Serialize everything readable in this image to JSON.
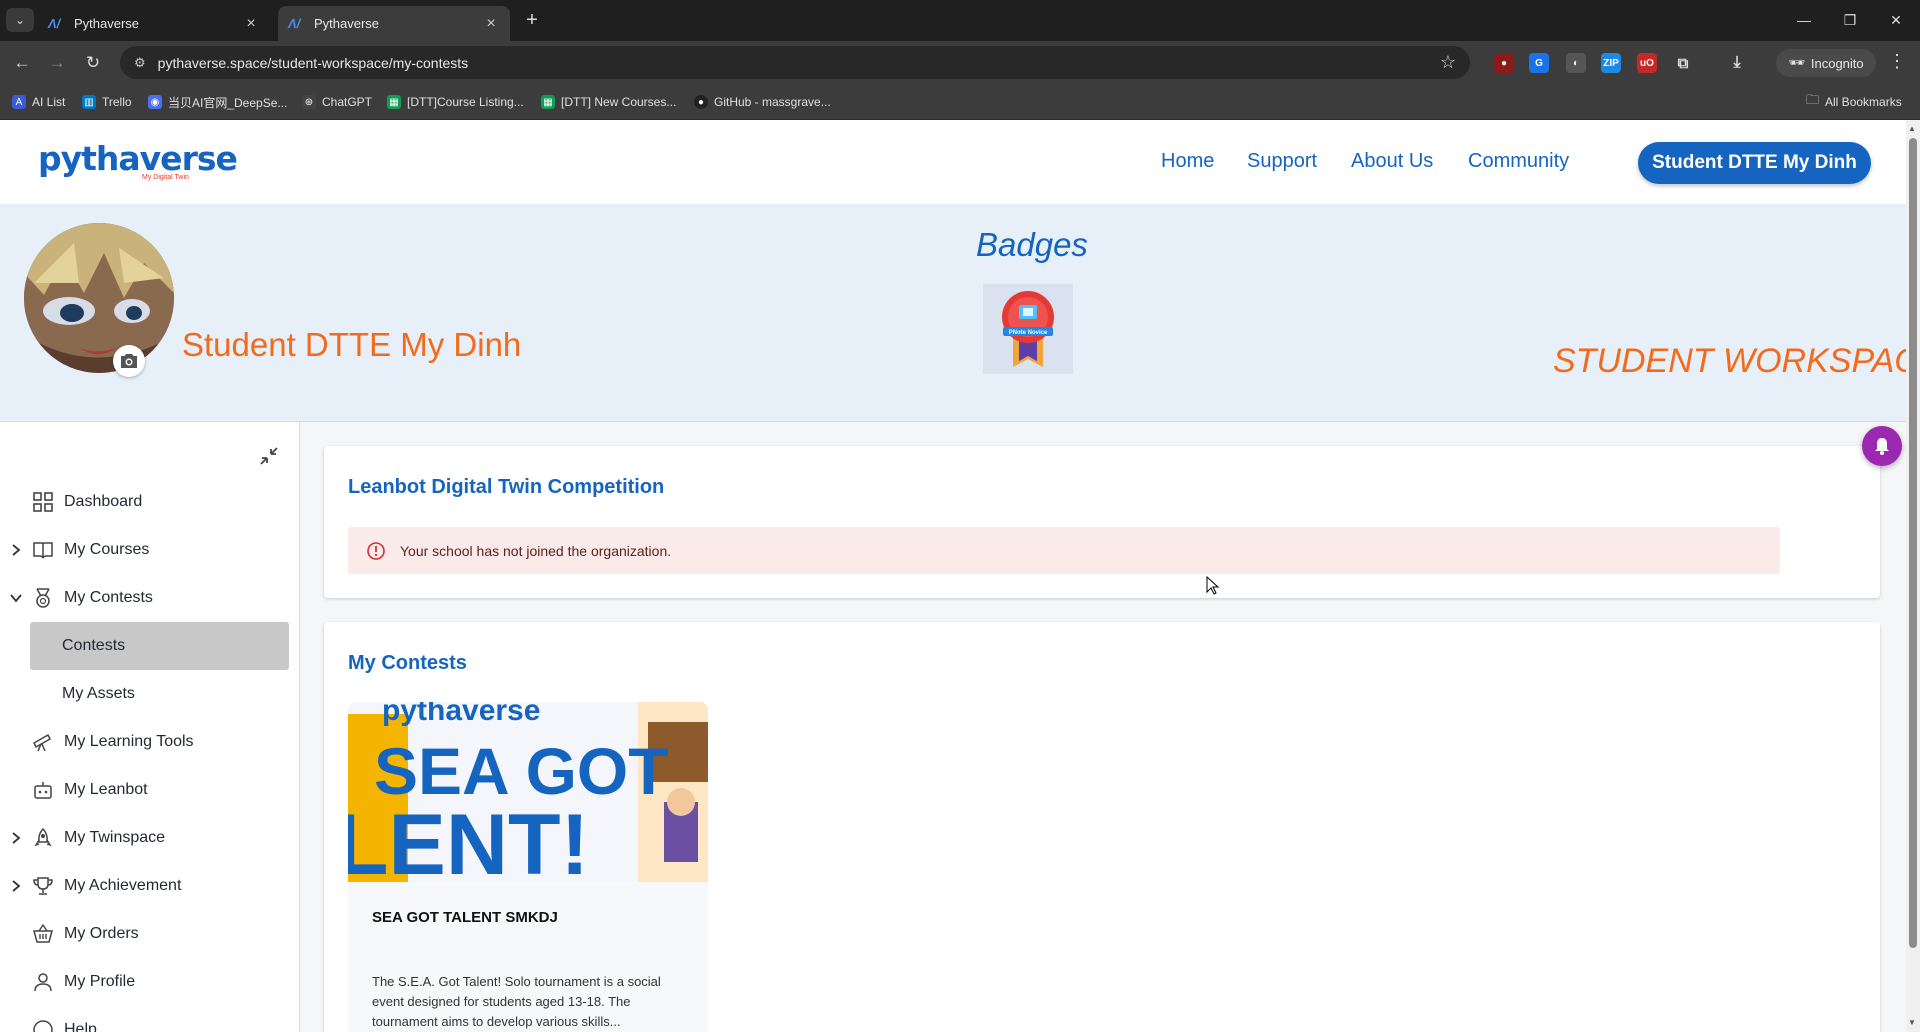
{
  "browser": {
    "tabs": [
      {
        "title": "Pythaverse"
      },
      {
        "title": "Pythaverse"
      }
    ],
    "url": "pythaverse.space/student-workspace/my-contests",
    "incognito_label": "Incognito",
    "bookmarks": [
      {
        "label": "AI List"
      },
      {
        "label": "Trello"
      },
      {
        "label": "当贝AI官网_DeepSe..."
      },
      {
        "label": "ChatGPT"
      },
      {
        "label": "[DTT]Course Listing..."
      },
      {
        "label": "[DTT] New Courses..."
      },
      {
        "label": "GitHub - massgrave..."
      }
    ],
    "all_bookmarks": "All Bookmarks"
  },
  "header": {
    "logo_text": "pythaverse",
    "logo_sub": "My Digital Twin",
    "nav": [
      {
        "label": "Home"
      },
      {
        "label": "Support"
      },
      {
        "label": "About Us"
      },
      {
        "label": "Community"
      }
    ],
    "profile_button": "Student DTTE My Dinh"
  },
  "hero": {
    "student_name": "Student DTTE My Dinh",
    "badges_title": "Badges",
    "badge_label": "PNote Novice",
    "workspace_title": "STUDENT WORKSPACE"
  },
  "sidebar": {
    "items": [
      {
        "label": "Dashboard"
      },
      {
        "label": "My Courses"
      },
      {
        "label": "My Contests"
      },
      {
        "label": "Contests"
      },
      {
        "label": "My Assets"
      },
      {
        "label": "My Learning Tools"
      },
      {
        "label": "My Leanbot"
      },
      {
        "label": "My Twinspace"
      },
      {
        "label": "My Achievement"
      },
      {
        "label": "My Orders"
      },
      {
        "label": "My Profile"
      },
      {
        "label": "Help"
      }
    ]
  },
  "competition": {
    "title": "Leanbot Digital Twin Competition",
    "alert": "Your school has not joined the organization."
  },
  "contests": {
    "title": "My Contests",
    "items": [
      {
        "image_text_top": "pythaverse",
        "image_text_1": "SEA GOT",
        "image_text_2": "LENT!",
        "name": "SEA GOT TALENT SMKDJ",
        "description": "The S.E.A. Got Talent! Solo tournament is a social event designed for students aged 13-18. The tournament aims to develop various skills..."
      }
    ]
  },
  "colors": {
    "brand_blue": "#1565c0",
    "accent_orange": "#f26b1d",
    "alert_bg": "#fbeaea",
    "notification_purple": "#9c27b0"
  }
}
